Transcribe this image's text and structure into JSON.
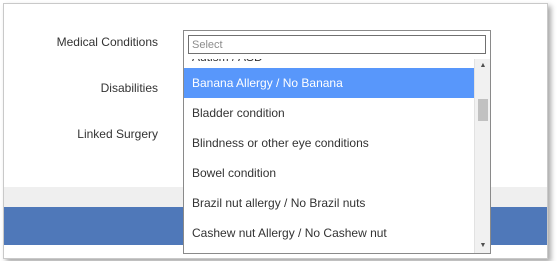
{
  "form": {
    "medical_conditions_label": "Medical Conditions",
    "disabilities_label": "Disabilities",
    "linked_surgery_label": "Linked Surgery"
  },
  "dropdown": {
    "search_placeholder": "Select",
    "search_value": "",
    "options": [
      "Autism / ASD",
      "Banana Allergy / No Banana",
      "Bladder condition",
      "Blindness or other eye conditions",
      "Bowel condition",
      "Brazil nut allergy / No Brazil nuts",
      "Cashew nut Allergy / No Cashew nut"
    ],
    "highlighted_option": "Banana Allergy / No Banana"
  },
  "scrollbar": {
    "up_arrow_icon": "triangle-up-icon",
    "down_arrow_icon": "triangle-down-icon"
  },
  "colors": {
    "highlight": "#5897fb",
    "footer_band": "#4f78b9",
    "grey_band": "#efefef"
  }
}
